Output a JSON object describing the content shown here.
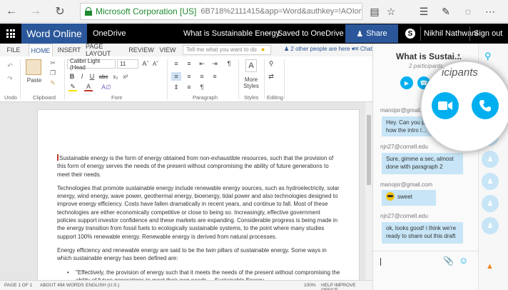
{
  "browser": {
    "site_identity": "Microsoft Corporation [US]",
    "url": "6B718%2111415&app=Word&authkey=!AOIonsfy6qC6n_0&"
  },
  "office": {
    "app_name": "Word Online",
    "onedrive": "OneDrive",
    "doc_title": "What is Sustainable Energy",
    "separator": "-",
    "save_status": "Saved to OneDrive",
    "share_label": "Share",
    "user_name": "Nikhil Nathwani",
    "sign_out": "Sign out"
  },
  "ribbon": {
    "tabs": [
      "FILE",
      "HOME",
      "INSERT",
      "PAGE LAYOUT",
      "REVIEW",
      "VIEW"
    ],
    "active_tab": "HOME",
    "tell_me_placeholder": "Tell me what you want to do",
    "others_editing": "2 other people are here",
    "chat_label": "Chat",
    "font_name": "Calibri Light (Head",
    "font_size": "11",
    "paste_label": "Paste",
    "styles_label": "More Styles",
    "groups": {
      "undo": "Undo",
      "clipboard": "Clipboard",
      "font": "Font",
      "paragraph": "Paragraph",
      "styles": "Styles",
      "editing": "Editing"
    }
  },
  "document": {
    "para1": "Sustainable energy is the form of energy obtained from non-exhaustible resources, such that the provision of this form of energy serves the needs of the present without compromising the ability of future generations to meet their needs.",
    "para2": "Technologies that promote sustainable energy include renewable energy sources, such as hydroelectricity, solar energy, wind energy, wave power, geothermal energy, bioenergy, tidal power and also technologies designed to improve energy efficiency. Costs have fallen dramatically in recent years, and continue to fall. Most of these technologies are either economically competitive or close to being so. Increasingly, effective government policies support investor confidence and these markets are expanding. Considerable progress is being made in the energy transition from fossil fuels to ecologically sustainable systems, to the point where many studies support 100% renewable energy. Renewable energy is derived from natural processes.",
    "para3": "Energy efficiency and renewable energy are said to be the twin pillars of sustainable energy. Some ways in which sustainable energy has been defined are:",
    "bullet1": "\"Effectively, the provision of energy such that it meets the needs of the present without compromising the ability of future generations to meet their own needs. ...Sustainable Energy"
  },
  "status_bar": {
    "page": "PAGE 1 OF 1",
    "words": "ABOUT 494 WORDS",
    "language": "ENGLISH (U.S.)",
    "zoom": "100%",
    "feedback": "HELP IMPROVE OFFICE"
  },
  "chat": {
    "title": "What is Sustai...",
    "participants": "2 participants",
    "messages": [
      {
        "sender": "manojsr@gmail.com",
        "text": "Hey. Can you pleas... know how the intro l..."
      },
      {
        "sender": "njn27@cornell.edu",
        "text": "Sure, gimme a sec, almost done with paragraph 2"
      },
      {
        "sender": "manojsr@gmail.com",
        "text": "sweet",
        "emoji": "smile-emoji"
      },
      {
        "sender": "njn27@cornell.edu",
        "text": "ok, looks good! i think we're ready to share out this draft"
      }
    ]
  },
  "magnifier": {
    "text": "icipants"
  },
  "colors": {
    "word_blue": "#2b579a",
    "skype_blue": "#00aff0",
    "bubble": "#c7e5f6",
    "secure_green": "#1e8a2e"
  }
}
